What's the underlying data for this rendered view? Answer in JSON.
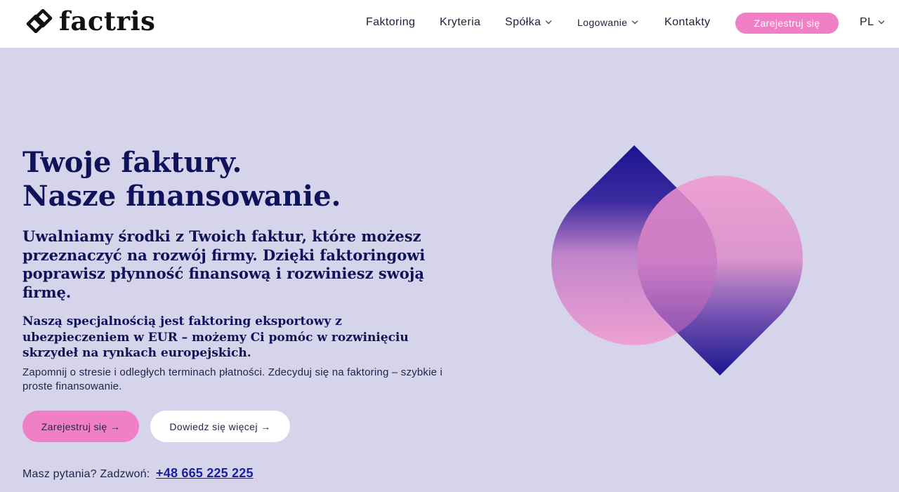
{
  "brand": {
    "name": "factris",
    "logo_icon": "factris-logo-icon"
  },
  "nav": {
    "items": [
      {
        "label": "Faktoring"
      },
      {
        "label": "Kryteria"
      },
      {
        "label": "Spółka"
      },
      {
        "label": "Logowanie"
      },
      {
        "label": "Kontakty"
      }
    ],
    "register_label": "Zarejestruj się",
    "language": "PL"
  },
  "hero": {
    "headline_line1": "Twoje faktury.",
    "headline_line2": "Nasze finansowanie.",
    "lead": "Uwalniamy środki z Twoich faktur, które możesz przeznaczyć na rozwój firmy. Dzięki faktoringowi poprawisz płynność finansową i rozwiniesz swoją firmę.",
    "specialty": "Naszą specjalnością jest faktoring eksportowy z ubezpieczeniem w EUR – możemy Ci pomóc w rozwinięciu skrzydeł na rynkach europejskich.",
    "note": "Zapomnij o stresie i odległych terminach płatności. Zdecyduj się na faktoring – szybkie i proste finansowanie.",
    "primary_button": "Zarejestruj się →",
    "secondary_button": "Dowiedz się więcej →",
    "phone_prompt": "Masz pytania? Zadzwoń:",
    "phone": "+48 665 225 225"
  },
  "colors": {
    "accent_pink": "#f17fc6",
    "navy": "#10125a",
    "background": "#d5d4ea"
  }
}
